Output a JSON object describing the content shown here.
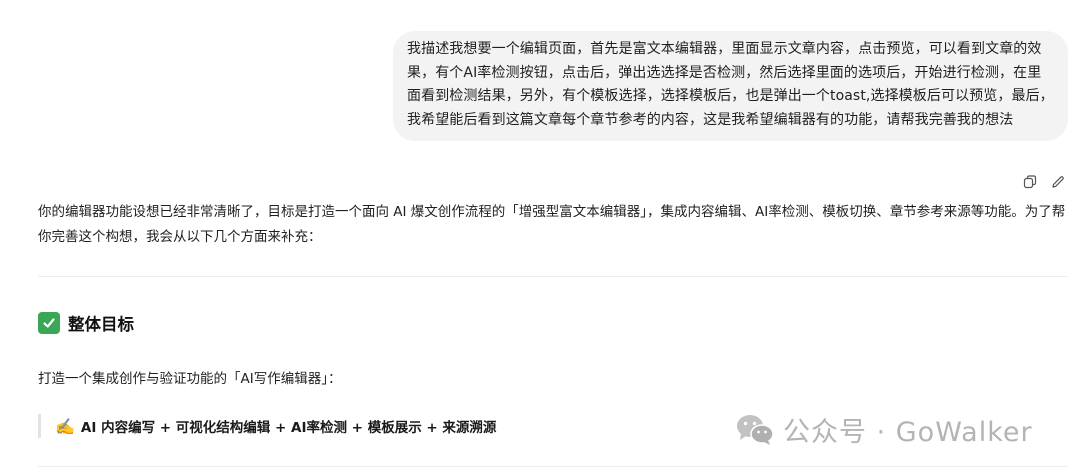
{
  "user_message": {
    "text": "我描述我想要一个编辑页面，首先是富文本编辑器，里面显示文章内容，点击预览，可以看到文章的效果，有个AI率检测按钮，点击后，弹出选选择是否检测，然后选择里面的选项后，开始进行检测，在里面看到检测结果，另外，有个模板选择，选择模板后，也是弹出一个toast,选择模板后可以预览，最后，我希望能后看到这篇文章每个章节参考的内容，这是我希望编辑器有的功能，请帮我完善我的想法"
  },
  "message_actions": {
    "copy_icon": "copy-icon",
    "edit_icon": "pencil-icon"
  },
  "assistant_reply": {
    "intro": "你的编辑器功能设想已经非常清晰了，目标是打造一个面向 AI 爆文创作流程的「增强型富文本编辑器」，集成内容编辑、AI率检测、模板切换、章节参考来源等功能。为了帮你完善这个构想，我会从以下几个方面来补充：",
    "section_title": "整体目标",
    "section_icon": "check-mark-icon",
    "section_intro": "打造一个集成创作与验证功能的「AI写作编辑器」：",
    "quote_emoji": "✍️",
    "quote_text": "AI 内容编写 + 可视化结构编辑 + AI率检测 + 模板展示 + 来源溯源"
  },
  "watermark": {
    "icon": "wechat-icon",
    "text": "公众号 · GoWalker"
  },
  "colors": {
    "bubble_bg": "#f3f3f3",
    "check_green": "#3aa757",
    "watermark_gray": "#b4b4b4"
  }
}
